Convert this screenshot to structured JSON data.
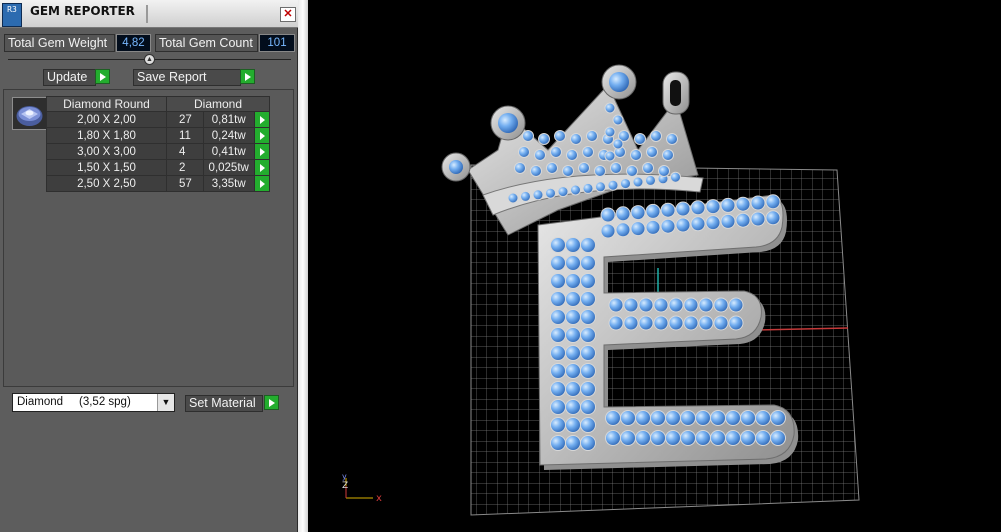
{
  "window": {
    "title": "GEM REPORTER",
    "close_glyph": "✕",
    "app_icon_text": "R3"
  },
  "summary": {
    "weight_label": "Total Gem Weight",
    "weight_value": "4,82",
    "count_label": "Total Gem Count",
    "count_value": "101"
  },
  "actions": {
    "update_label": "Update",
    "save_label": "Save Report"
  },
  "gem_table": {
    "shape_header": "Diamond Round",
    "type_header": "Diamond",
    "rows": [
      {
        "size": "2,00 X 2,00",
        "count": "27",
        "weight": "0,81tw"
      },
      {
        "size": "1,80 X 1,80",
        "count": "11",
        "weight": "0,24tw"
      },
      {
        "size": "3,00 X 3,00",
        "count": "4",
        "weight": "0,41tw"
      },
      {
        "size": "1,50 X 1,50",
        "count": "2",
        "weight": "0,025tw"
      },
      {
        "size": "2,50 X 2,50",
        "count": "57",
        "weight": "3,35tw"
      }
    ]
  },
  "material": {
    "selected": "Diamond     (3,52 spg)",
    "set_label": "Set Material"
  },
  "viewport": {
    "axis_z": "Z",
    "axis_y": "y",
    "axis_x": "x"
  },
  "colors": {
    "panel_bg": "#5d5d5d",
    "go_green": "#23ad2e",
    "value_text": "#78b8ff",
    "gem_blue": "#6aa6e8",
    "metal": "#c7c7c7",
    "grid": "#7b7b7b"
  }
}
